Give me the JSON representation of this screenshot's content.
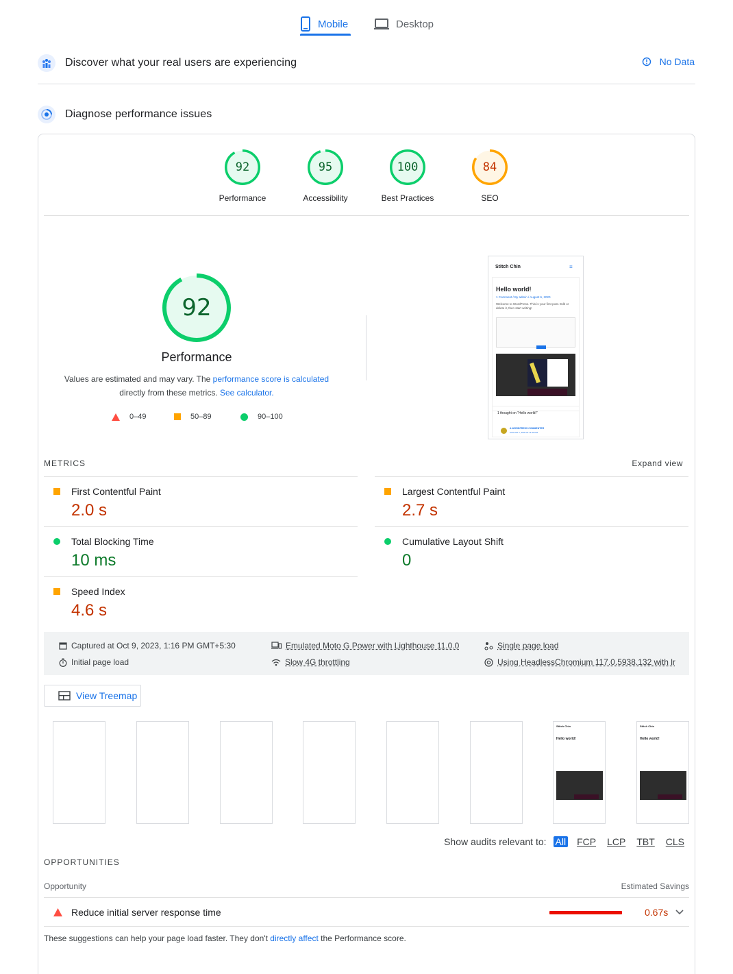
{
  "tabs": {
    "mobile": "Mobile",
    "desktop": "Desktop"
  },
  "crux": {
    "title": "Discover what your real users are experiencing",
    "status": "No Data"
  },
  "lab": {
    "title": "Diagnose performance issues"
  },
  "categories": [
    {
      "score": "92",
      "label": "Performance",
      "color": "#0cce6b",
      "text_color": "#0d652d",
      "fraction": 0.92
    },
    {
      "score": "95",
      "label": "Accessibility",
      "color": "#0cce6b",
      "text_color": "#0d652d",
      "fraction": 0.95
    },
    {
      "score": "100",
      "label": "Best Practices",
      "color": "#0cce6b",
      "text_color": "#0d652d",
      "fraction": 1.0
    },
    {
      "score": "84",
      "label": "SEO",
      "color": "#ffa400",
      "text_color": "#c33300",
      "fraction": 0.84
    }
  ],
  "performance": {
    "score": "92",
    "fraction": 0.92,
    "label": "Performance",
    "desc_1": "Values are estimated and may vary. The ",
    "desc_link_1": "performance score is calculated",
    "desc_2": "directly from these metrics. ",
    "desc_link_2": "See calculator.",
    "legend": {
      "fail": "0–49",
      "average": "50–89",
      "pass": "90–100"
    }
  },
  "screenshot": {
    "site": "Stitch Chin",
    "post_title": "Hello world!",
    "meta": "1 Comment / By admin / August 6, 2020",
    "excerpt": "Welcome to WordPress. This is your first post. Edit or delete it, then start writing!",
    "comment_head": "1 thought on “Hello world!”",
    "commenter": "A WORDPRESS COMMENTER",
    "comment_date": "AUGUST 7, 2020 AT 11:30 PM"
  },
  "metrics": {
    "heading": "METRICS",
    "expand": "Expand view",
    "fcp": {
      "label": "First Contentful Paint",
      "value": "2.0 s"
    },
    "lcp": {
      "label": "Largest Contentful Paint",
      "value": "2.7 s"
    },
    "tbt": {
      "label": "Total Blocking Time",
      "value": "10 ms"
    },
    "cls": {
      "label": "Cumulative Layout Shift",
      "value": "0"
    },
    "si": {
      "label": "Speed Index",
      "value": "4.6 s"
    }
  },
  "runtime": {
    "captured": "Captured at Oct 9, 2023, 1:16 PM GMT+5:30",
    "initial": "Initial page load",
    "device": "Emulated Moto G Power with Lighthouse 11.0.0",
    "throttling": "Slow 4G throttling",
    "single": "Single page load",
    "browser": "Using HeadlessChromium 117.0.5938.132 with lr"
  },
  "treemap": {
    "label": "View Treemap"
  },
  "filters": {
    "label": "Show audits relevant to:",
    "items": [
      "All",
      "FCP",
      "LCP",
      "TBT",
      "CLS"
    ]
  },
  "opportunities": {
    "heading": "OPPORTUNITIES",
    "col_opportunity": "Opportunity",
    "col_savings": "Estimated Savings",
    "items": [
      {
        "title": "Reduce initial server response time",
        "savings": "0.67s"
      }
    ],
    "note_1": "These suggestions can help your page load faster. They don't ",
    "note_link": "directly affect",
    "note_2": " the Performance score."
  },
  "colors": {
    "accent": "#1a73e8",
    "pass": "#0cce6b",
    "average": "#ffa400",
    "fail": "#ff4e42"
  }
}
